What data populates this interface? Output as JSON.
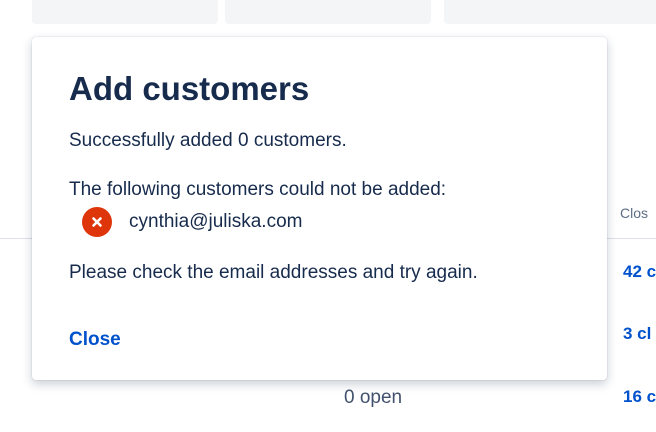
{
  "background": {
    "column_header": "Clos",
    "closed_links": [
      "42 c",
      "3 cl",
      "16 c"
    ],
    "open_text": "0 open"
  },
  "dialog": {
    "title": "Add customers",
    "success_message": "Successfully added 0 customers.",
    "failed_heading": "The following customers could not be added:",
    "failed_customers": [
      {
        "email": "cynthia@juliska.com",
        "icon": "error-icon"
      }
    ],
    "instruction": "Please check the email addresses and try again.",
    "close_label": "Close"
  },
  "colors": {
    "accent": "#0052CC",
    "error": "#DE350B",
    "text": "#172B4D"
  }
}
